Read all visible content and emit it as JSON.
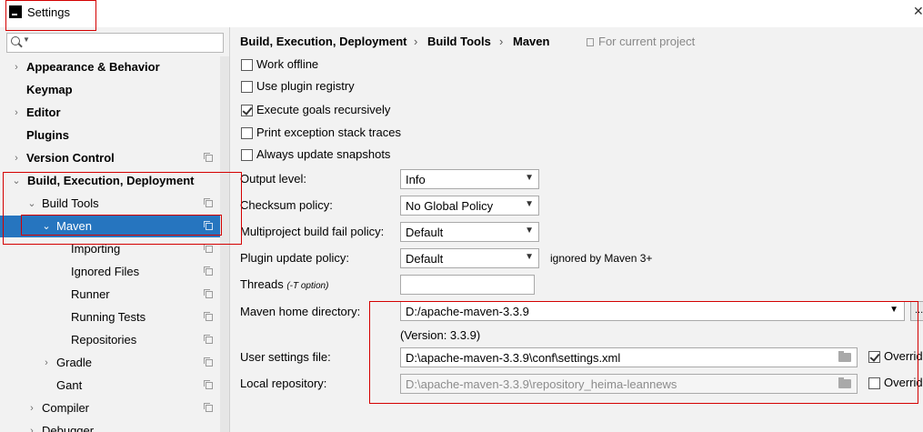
{
  "window": {
    "title": "Settings"
  },
  "search": {
    "placeholder": ""
  },
  "sidebar": {
    "items": [
      {
        "label": "Appearance & Behavior"
      },
      {
        "label": "Keymap"
      },
      {
        "label": "Editor"
      },
      {
        "label": "Plugins"
      },
      {
        "label": "Version Control"
      },
      {
        "label": "Build, Execution, Deployment"
      },
      {
        "label": "Build Tools"
      },
      {
        "label": "Maven"
      },
      {
        "label": "Importing"
      },
      {
        "label": "Ignored Files"
      },
      {
        "label": "Runner"
      },
      {
        "label": "Running Tests"
      },
      {
        "label": "Repositories"
      },
      {
        "label": "Gradle"
      },
      {
        "label": "Gant"
      },
      {
        "label": "Compiler"
      },
      {
        "label": "Debugger"
      }
    ]
  },
  "breadcrumb": {
    "items": [
      "Build, Execution, Deployment",
      "Build Tools",
      "Maven"
    ],
    "separator": "›",
    "scope": "For current project"
  },
  "options": {
    "work_offline": {
      "label": "Work offline",
      "checked": false
    },
    "plugin_registry": {
      "label": "Use plugin registry",
      "checked": false
    },
    "recursive": {
      "label": "Execute goals recursively",
      "checked": true
    },
    "exception_traces": {
      "label": "Print exception stack traces",
      "checked": false
    },
    "update_snapshots": {
      "label": "Always update snapshots",
      "checked": false
    }
  },
  "fields": {
    "output_level": {
      "label": "Output level:",
      "value": "Info"
    },
    "checksum_policy": {
      "label": "Checksum policy:",
      "value": "No Global Policy"
    },
    "fail_policy": {
      "label": "Multiproject build fail policy:",
      "value": "Default"
    },
    "plugin_update": {
      "label": "Plugin update policy:",
      "value": "Default",
      "note": "ignored by Maven 3+"
    },
    "threads": {
      "label": "Threads",
      "hint": "(-T option)",
      "value": ""
    },
    "maven_home": {
      "label": "Maven home directory:",
      "value": "D:/apache-maven-3.3.9",
      "version": "(Version: 3.3.9)",
      "browse": "..."
    },
    "user_settings": {
      "label": "User settings file:",
      "value": "D:\\apache-maven-3.3.9\\conf\\settings.xml",
      "override_label": "Overrid",
      "override_checked": true
    },
    "local_repo": {
      "label": "Local repository:",
      "value": "D:\\apache-maven-3.3.9\\repository_heima-leannews",
      "override_label": "Overrid",
      "override_checked": false
    }
  },
  "colors": {
    "selection": "#2675bf",
    "annotation": "#d40000",
    "panel_bg": "#f2f2f2"
  }
}
